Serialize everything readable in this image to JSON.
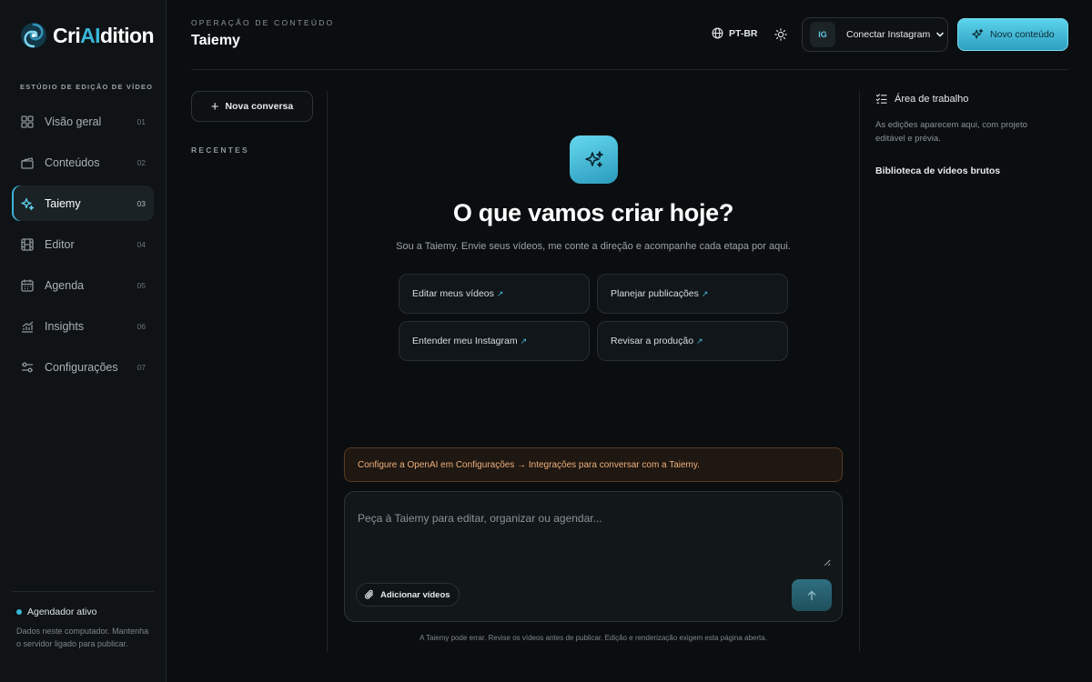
{
  "brand": {
    "name_prefix": "Cri",
    "name_ai": "AI",
    "name_suffix": "dition"
  },
  "sidebar": {
    "section_label": "ESTÚDIO DE EDIÇÃO DE VÍDEO",
    "items": [
      {
        "label": "Visão geral",
        "num": "01",
        "icon": "grid-icon"
      },
      {
        "label": "Conteúdos",
        "num": "02",
        "icon": "clapperboard-icon"
      },
      {
        "label": "Taiemy",
        "num": "03",
        "icon": "sparkles-icon",
        "active": true
      },
      {
        "label": "Editor",
        "num": "04",
        "icon": "film-icon"
      },
      {
        "label": "Agenda",
        "num": "05",
        "icon": "calendar-icon"
      },
      {
        "label": "Insights",
        "num": "06",
        "icon": "chart-icon"
      },
      {
        "label": "Configurações",
        "num": "07",
        "icon": "sliders-icon"
      }
    ],
    "status": {
      "label": "Agendador ativo",
      "note": "Dados neste computador. Mantenha o servidor ligado para publicar."
    }
  },
  "header": {
    "eyebrow": "OPERAÇÃO DE CONTEÚDO",
    "title": "Taiemy",
    "language": "PT-BR",
    "instagram": {
      "badge": "IG",
      "label": "Conectar Instagram"
    },
    "new_content_label": "Novo conteúdo"
  },
  "conversations": {
    "new_label": "Nova conversa",
    "recent_label": "RECENTES"
  },
  "main": {
    "title": "O que vamos criar hoje?",
    "subtitle": "Sou a Taiemy. Envie seus vídeos, me conte a direção e acompanhe cada etapa por aqui.",
    "suggestions": [
      "Editar meus vídeos",
      "Planejar publicações",
      "Entender meu Instagram",
      "Revisar a produção"
    ],
    "warning": "Configure a OpenAI em Configurações → Integrações para conversar com a Taiemy.",
    "composer": {
      "placeholder": "Peça à Taiemy para editar, organizar ou agendar...",
      "value": "",
      "attach_label": "Adicionar vídeos"
    },
    "disclaimer": "A Taiemy pode errar. Revise os vídeos antes de publicar. Edição e renderização exigem esta página aberta."
  },
  "workspace": {
    "title": "Área de trabalho",
    "description": "As edições aparecem aqui, com projeto editável e prévia.",
    "library_label": "Biblioteca de vídeos brutos"
  },
  "colors": {
    "accent": "#38b6d8",
    "background": "#0b0e10",
    "warning_text": "#f0b07a"
  }
}
